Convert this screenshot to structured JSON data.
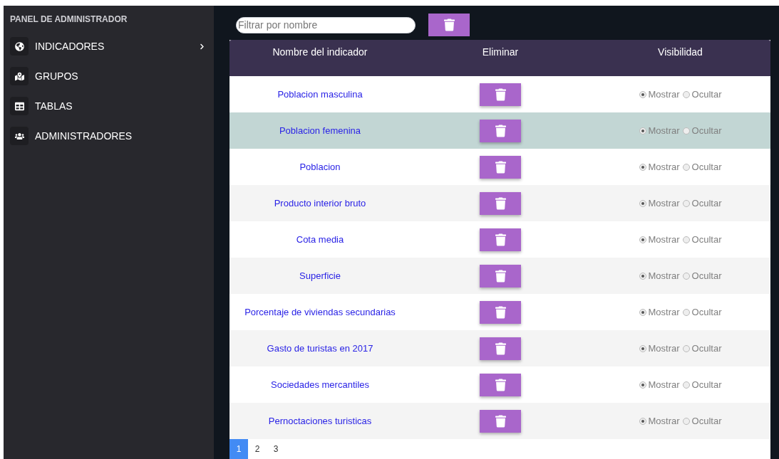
{
  "sidebar": {
    "title": "PANEL DE ADMINISTRADOR",
    "items": [
      {
        "label": "INDICADORES",
        "expandable": true
      },
      {
        "label": "GRUPOS",
        "expandable": false
      },
      {
        "label": "TABLAS",
        "expandable": false
      },
      {
        "label": "ADMINISTRADORES",
        "expandable": false
      }
    ]
  },
  "filter": {
    "placeholder": "Filtrar por nombre"
  },
  "table": {
    "columns": [
      "Nombre del indicador",
      "Eliminar",
      "Visibilidad"
    ],
    "rows": [
      {
        "name": "Poblacion masculina",
        "highlighted": false,
        "options": [
          {
            "label": "Mostrar",
            "selected": true
          },
          {
            "label": "Ocultar",
            "selected": false
          }
        ]
      },
      {
        "name": "Poblacion femenina",
        "highlighted": true,
        "options": [
          {
            "label": "Mostrar",
            "selected": true
          },
          {
            "label": "Ocultar",
            "selected": false
          }
        ]
      },
      {
        "name": "Poblacion",
        "highlighted": false,
        "options": [
          {
            "label": "Mostrar",
            "selected": true
          },
          {
            "label": "Ocultar",
            "selected": false
          }
        ]
      },
      {
        "name": "Producto interior bruto",
        "highlighted": false,
        "options": [
          {
            "label": "Mostrar",
            "selected": true
          },
          {
            "label": "Ocultar",
            "selected": false
          }
        ]
      },
      {
        "name": "Cota media",
        "highlighted": false,
        "options": [
          {
            "label": "Mostrar",
            "selected": true
          },
          {
            "label": "Ocultar",
            "selected": false
          }
        ]
      },
      {
        "name": "Superficie",
        "highlighted": false,
        "options": [
          {
            "label": "Mostrar",
            "selected": true
          },
          {
            "label": "Ocultar",
            "selected": false
          }
        ]
      },
      {
        "name": "Porcentaje de viviendas secundarias",
        "highlighted": false,
        "options": [
          {
            "label": "Mostrar",
            "selected": true
          },
          {
            "label": "Ocultar",
            "selected": false
          }
        ]
      },
      {
        "name": "Gasto de turistas en 2017",
        "highlighted": false,
        "options": [
          {
            "label": "Mostrar",
            "selected": true
          },
          {
            "label": "Ocultar",
            "selected": false
          }
        ]
      },
      {
        "name": "Sociedades mercantiles",
        "highlighted": false,
        "options": [
          {
            "label": "Mostrar",
            "selected": true
          },
          {
            "label": "Ocultar",
            "selected": false
          }
        ]
      },
      {
        "name": "Pernoctaciones turisticas",
        "highlighted": false,
        "options": [
          {
            "label": "Mostrar",
            "selected": true
          },
          {
            "label": "Ocultar",
            "selected": false
          }
        ]
      }
    ]
  },
  "pagination": [
    {
      "label": "1",
      "selected": true
    },
    {
      "label": "2",
      "selected": false
    },
    {
      "label": "3",
      "selected": false
    }
  ]
}
